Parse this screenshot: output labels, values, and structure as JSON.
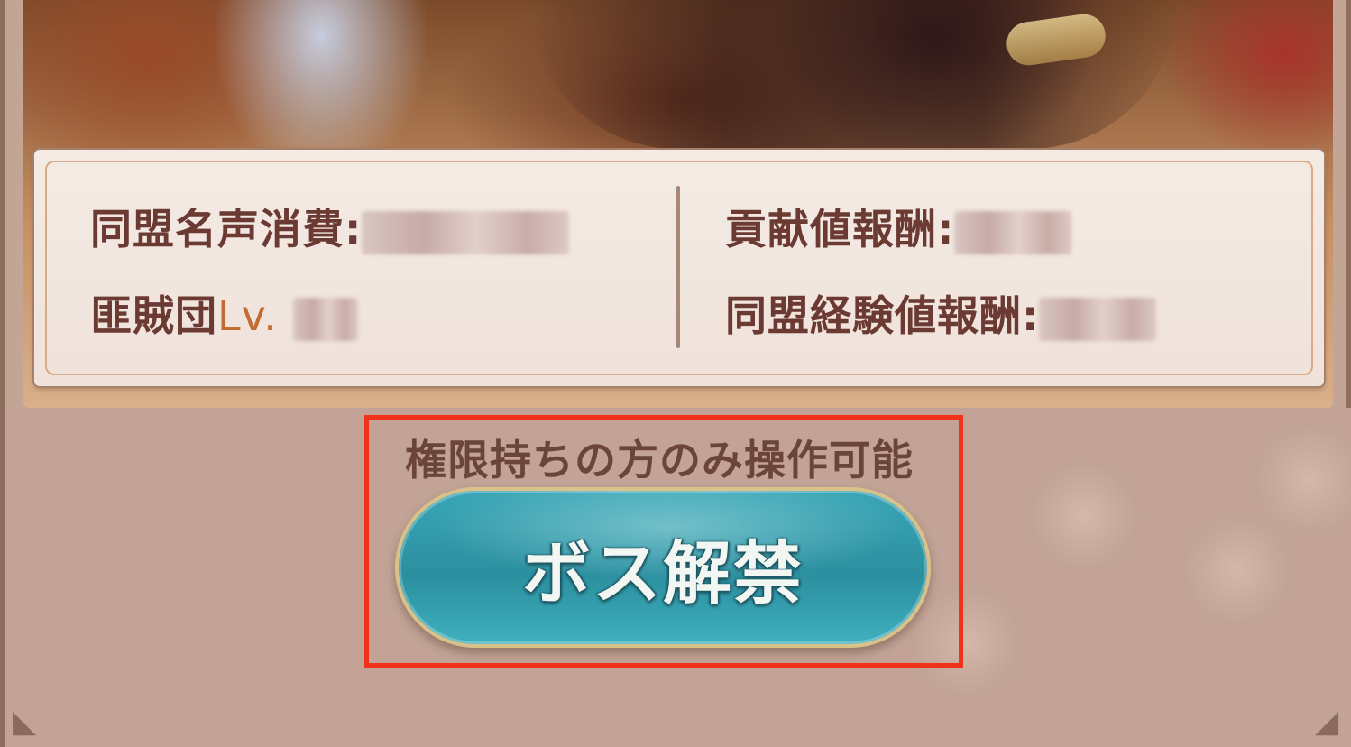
{
  "info": {
    "alliance_fame_cost_label": "同盟名声消費:",
    "bandit_level_label": "匪賊団",
    "bandit_level_prefix": "Lv.",
    "contribution_reward_label": "貢献値報酬:",
    "alliance_exp_reward_label": "同盟経験値報酬:"
  },
  "action": {
    "permission_note": "権限持ちの方のみ操作可能",
    "unlock_boss_label": "ボス解禁"
  },
  "colors": {
    "highlight": "#f0321c",
    "button": "#2b8f9f",
    "label_text": "#6b3a33",
    "level_accent": "#c26b32"
  }
}
